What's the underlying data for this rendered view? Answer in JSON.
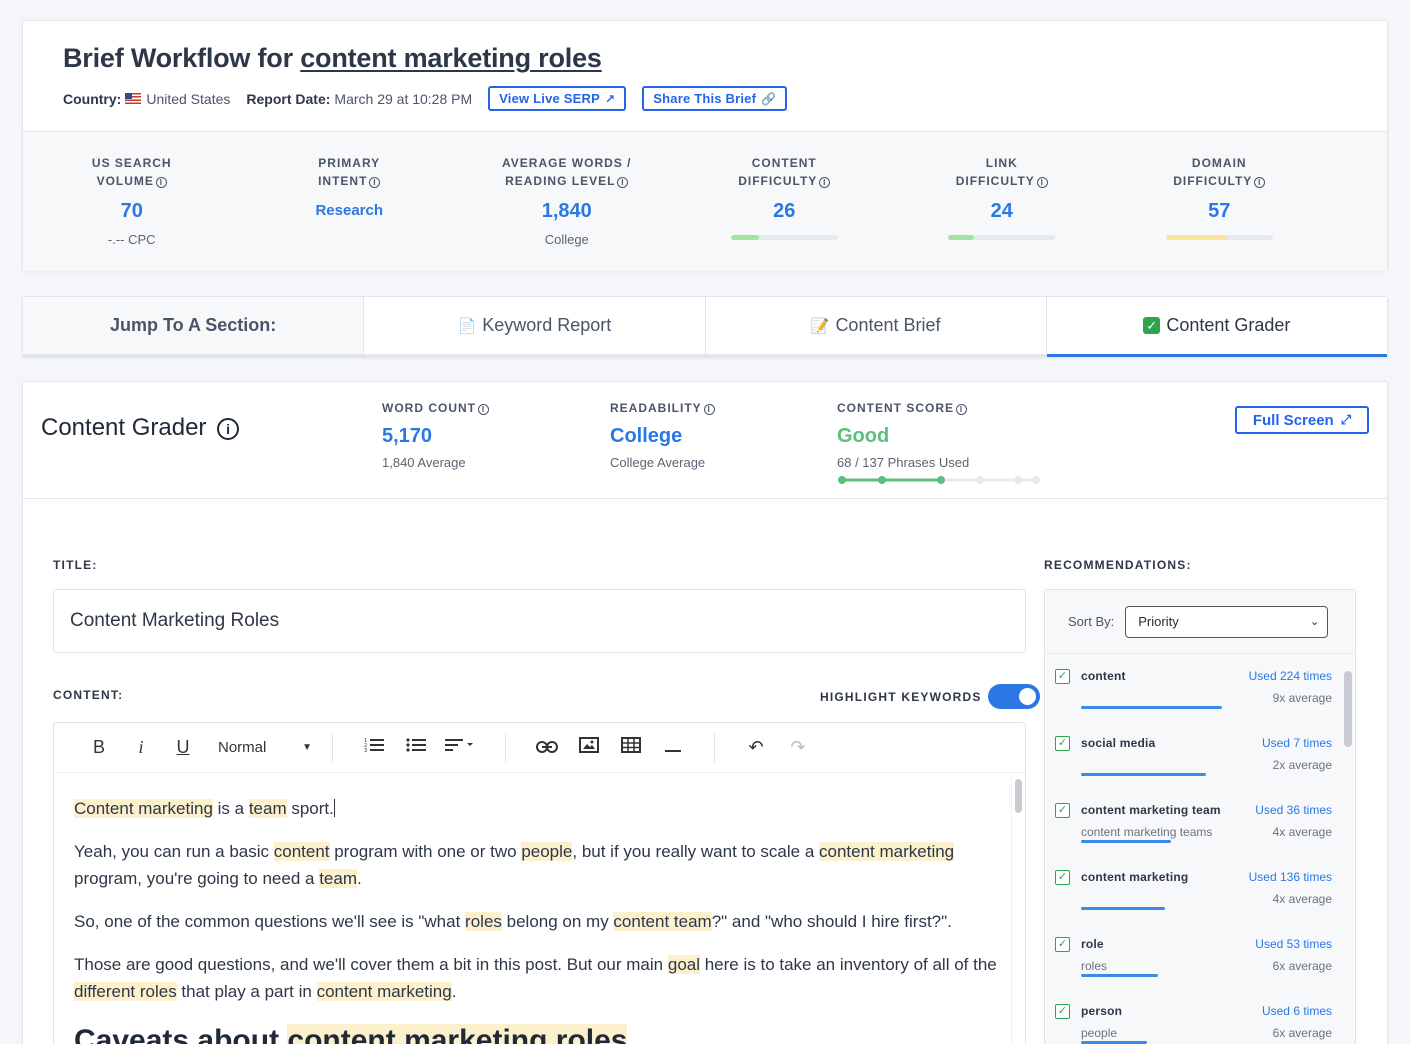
{
  "header": {
    "title_prefix": "Brief Workflow for",
    "title_keyword": "content marketing roles",
    "country_label": "Country:",
    "country_value": "United States",
    "report_date_label": "Report Date:",
    "report_date_value": "March 29 at 10:28 PM",
    "view_serp_label": "View Live SERP",
    "share_label": "Share This Brief"
  },
  "metrics": [
    {
      "label_line1": "US SEARCH",
      "label_line2": "VOLUME",
      "value": "70",
      "sub": "-.-- CPC"
    },
    {
      "label_line1": "PRIMARY",
      "label_line2": "INTENT",
      "value": "Research"
    },
    {
      "label_line1": "AVERAGE WORDS /",
      "label_line2": "READING LEVEL",
      "value": "1,840",
      "sub": "College"
    },
    {
      "label_line1": "CONTENT",
      "label_line2": "DIFFICULTY",
      "value": "26",
      "bar_fraction": 0.26,
      "bar_color": "#a3e4a3"
    },
    {
      "label_line1": "LINK",
      "label_line2": "DIFFICULTY",
      "value": "24",
      "bar_fraction": 0.24,
      "bar_color": "#a3e4a3"
    },
    {
      "label_line1": "DOMAIN",
      "label_line2": "DIFFICULTY",
      "value": "57",
      "bar_fraction": 0.57,
      "bar_color": "#fbe3a0"
    }
  ],
  "tabs": {
    "jump_label": "Jump To A Section:",
    "keyword_report": "Keyword Report",
    "content_brief": "Content Brief",
    "content_grader": "Content Grader"
  },
  "grader": {
    "title": "Content Grader",
    "word_count_label": "WORD COUNT",
    "word_count_value": "5,170",
    "word_count_sub": "1,840 Average",
    "readability_label": "READABILITY",
    "readability_value": "College",
    "readability_sub": "College Average",
    "score_label": "CONTENT SCORE",
    "score_value": "Good",
    "score_sub": "68 / 137 Phrases Used",
    "score_fraction": 0.496,
    "fullscreen_label": "Full Screen",
    "title_section_label": "TITLE:",
    "title_value": "Content Marketing Roles",
    "content_section_label": "CONTENT:",
    "highlight_label": "HIGHLIGHT KEYWORDS",
    "highlight_on": true,
    "recommendations_label": "RECOMMENDATIONS:"
  },
  "toolbar": {
    "bold": "B",
    "italic": "i",
    "underline": "U",
    "format_value": "Normal"
  },
  "editor": {
    "p1": {
      "a": "Content marketing",
      "b": " is a ",
      "c": "team",
      "d": " sport."
    },
    "p2": {
      "a": "Yeah, you can run a basic ",
      "b": "content",
      "c": " program with one or two ",
      "d": "people",
      "e": ", but if you really want to scale a ",
      "f": "content marketing",
      "g": " program, you're going to need a ",
      "h": "team",
      "i": "."
    },
    "p3": {
      "a": "So, one of the common questions we'll see is \"what ",
      "b": "roles",
      "c": " belong on my ",
      "d": "content team",
      "e": "?\" and \"who should I hire first?\"."
    },
    "p4": {
      "a": "Those are good questions, and we'll cover them a bit in this post. But our main ",
      "b": "goal",
      "c": " here is to take an inventory of all of the ",
      "d": "different roles",
      "e": " that play a part in ",
      "f": "content marketing",
      "g": "."
    },
    "h2": {
      "a": "Caveats about ",
      "b": "content marketing roles"
    }
  },
  "recommendations": {
    "sort_label": "Sort By:",
    "sort_value": "Priority",
    "items": [
      {
        "name": "content",
        "alt": "",
        "used": "Used 224 times",
        "avg": "9x average",
        "fraction": 0.64
      },
      {
        "name": "social media",
        "alt": "",
        "used": "Used 7 times",
        "avg": "2x average",
        "fraction": 0.57
      },
      {
        "name": "content marketing team",
        "alt": "content marketing teams",
        "used": "Used 36 times",
        "avg": "4x average",
        "fraction": 0.41
      },
      {
        "name": "content marketing",
        "alt": "",
        "used": "Used 136 times",
        "avg": "4x average",
        "fraction": 0.38
      },
      {
        "name": "role",
        "alt": "roles",
        "used": "Used 53 times",
        "avg": "6x average",
        "fraction": 0.35
      },
      {
        "name": "person",
        "alt": "people",
        "used": "Used 6 times",
        "avg": "6x average",
        "fraction": 0.3
      }
    ]
  },
  "colors": {
    "accent": "#2b78e4",
    "good": "#5ac07b",
    "highlight": "#fdf1cd"
  }
}
